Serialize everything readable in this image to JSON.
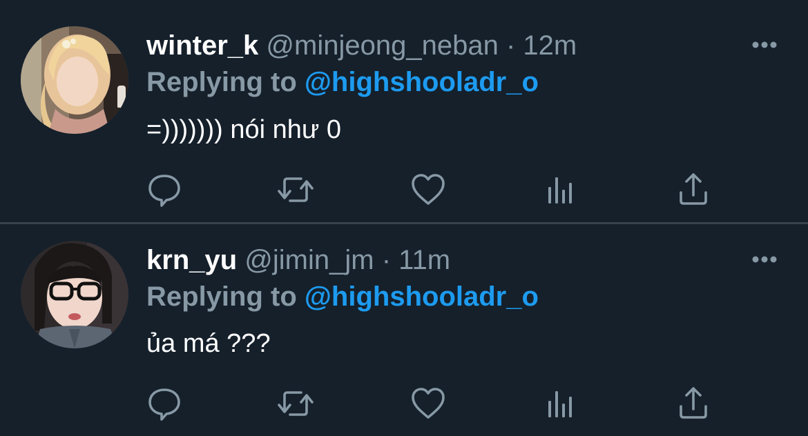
{
  "tweets": [
    {
      "display_name": "winter_k",
      "handle": "@minjeong_neban",
      "separator": "·",
      "time": "12m",
      "reply_prefix": "Replying to",
      "reply_target": "@highshooladr_o",
      "text": "=))))))) nói như 0"
    },
    {
      "display_name": "krn_yu",
      "handle": "@jimin_jm",
      "separator": "·",
      "time": "11m",
      "reply_prefix": "Replying to",
      "reply_target": "@highshooladr_o",
      "text": "ủa má ???"
    }
  ],
  "icons": {
    "more": "more-icon",
    "reply": "reply-icon",
    "retweet": "retweet-icon",
    "like": "like-icon",
    "analytics": "analytics-icon",
    "share": "share-icon"
  },
  "colors": {
    "background": "#15202b",
    "divider": "#38444d",
    "secondary_text": "#8899a6",
    "accent": "#1d9bf0",
    "primary_text": "#ffffff"
  }
}
